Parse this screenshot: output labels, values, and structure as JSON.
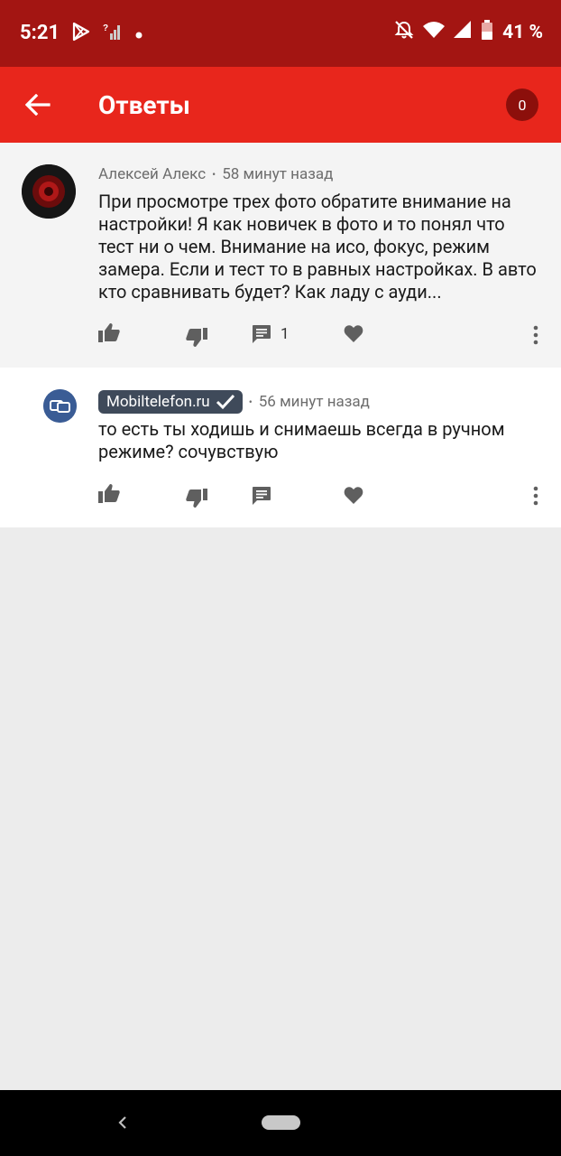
{
  "status_bar": {
    "time": "5:21",
    "battery": "41 %",
    "left_icons": [
      "play-store-icon",
      "no-signal-icon",
      "dot-icon"
    ],
    "right_icons": [
      "bell-off-icon",
      "wifi-icon",
      "signal-icon",
      "battery-icon"
    ]
  },
  "app_bar": {
    "title": "Ответы",
    "count": "0",
    "back_icon": "arrow-left-icon"
  },
  "comments": [
    {
      "author": "Алексей Алекс",
      "time": "58 минут назад",
      "text": "При просмотре трех фото обратите внимание на настройки! Я как новичек в фото и то понял что тест ни о чем. Внимание на исо, фокус, режим замера. Если и тест то в равных настройках. В авто кто сравнивать будет? Как ладу с ауди...",
      "reply_count": "1"
    },
    {
      "author": "Mobiltelefon.ru",
      "time": "56 минут назад",
      "text": "то есть ты ходишь и снимаешь всегда в ручном режиме? сочувствую",
      "verified": true
    }
  ],
  "colors": {
    "status_bar": "#a31512",
    "app_bar": "#e8261c",
    "badge": "#8c0f0b",
    "verified_badge": "#3f4a5a"
  }
}
